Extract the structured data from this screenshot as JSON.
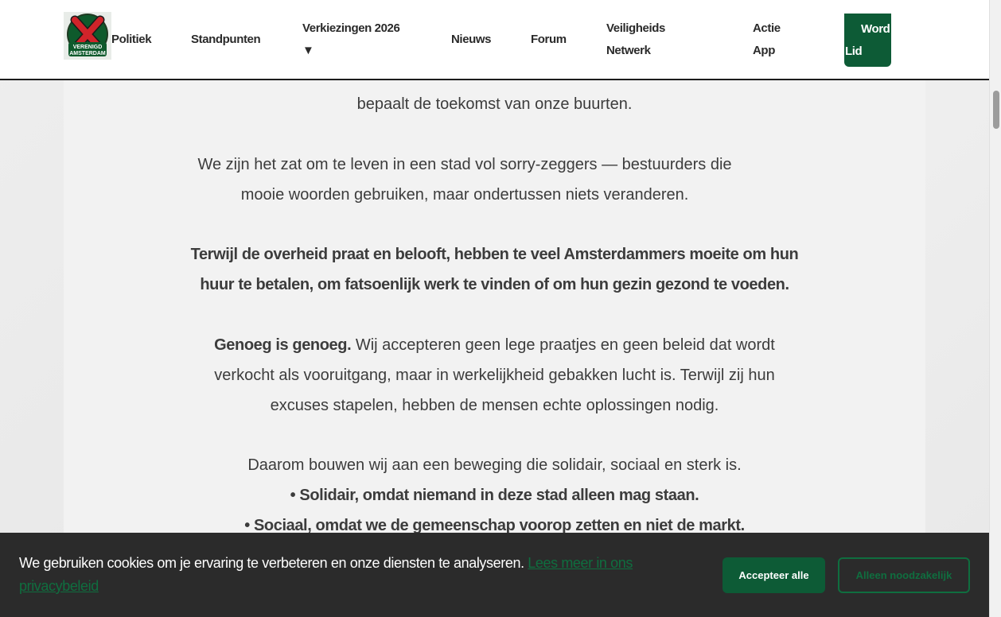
{
  "header": {
    "logo_alt": "VERENIGD AMSTERDAM",
    "nav": {
      "politiek": "Politiek",
      "standpunten": "Standpunten",
      "verkiezingen_line1": "Verkiezingen 2026",
      "verkiezingen_line2": "▼",
      "nieuws": "Nieuws",
      "forum": "Forum",
      "veiligheid_line1": "Veiligheids",
      "veiligheid_line2": "Netwerk",
      "actie_line1": "Actie",
      "actie_line2": "App"
    },
    "cta_line1": "Word",
    "cta_line2": "Lid"
  },
  "content": {
    "line_partial": "bepaalt de toekomst van onze buurten.",
    "p1": "We zijn het zat om te leven in een stad vol sorry-zeggers — bestuurders die mooie woorden gebruiken, maar ondertussen niets veranderen.",
    "p2": "Terwijl de overheid praat en belooft, hebben te veel Amsterdammers moeite om hun huur te betalen, om fatsoenlijk werk te vinden of om hun gezin gezond te voeden.",
    "p3_bold": "Genoeg is genoeg.",
    "p3_rest": " Wij accepteren geen lege praatjes en geen beleid dat wordt verkocht als vooruitgang, maar in werkelijkheid gebakken lucht is. Terwijl zij hun excuses stapelen, hebben de mensen echte oplossingen nodig.",
    "p4": "Daarom bouwen wij aan een beweging die solidair, sociaal en sterk is.",
    "bullet1": "• Solidair, omdat niemand in deze stad alleen mag staan.",
    "bullet2": "• Sociaal, omdat we de gemeenschap voorop zetten en niet de markt."
  },
  "cookie": {
    "text": "We gebruiken cookies om je ervaring te verbeteren en onze diensten te analyseren.",
    "link": "Lees meer in ons privacybeleid",
    "accept": "Accepteer alle",
    "necessary": "Alleen noodzakelijk"
  },
  "colors": {
    "brand_green": "#0d5b36",
    "cookie_bg": "#2b2b2b",
    "text": "#3c3c3c"
  }
}
